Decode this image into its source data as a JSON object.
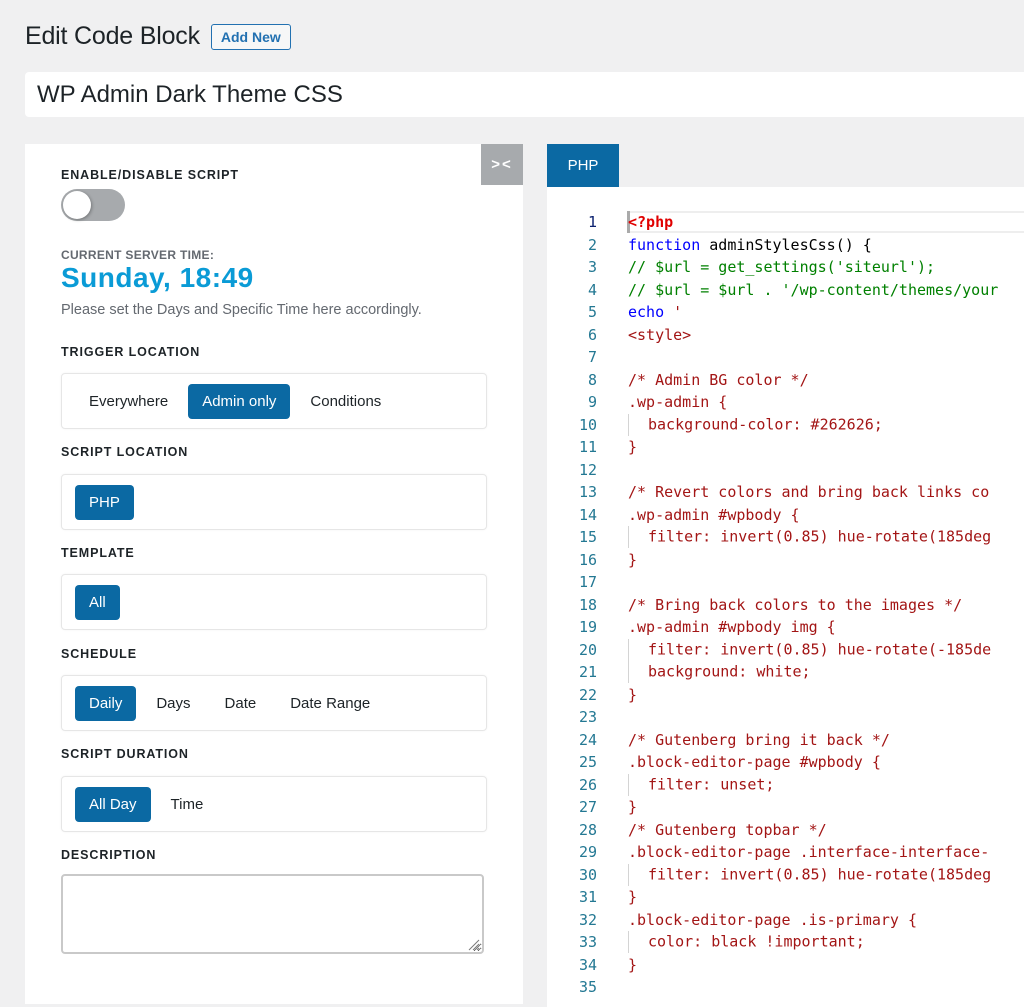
{
  "header": {
    "title": "Edit Code Block",
    "add_new_label": "Add New"
  },
  "post_title": "WP Admin Dark Theme CSS",
  "settings": {
    "collapse_icon": "collapse-arrows-icon",
    "collapse_label": "><",
    "enable_label": "ENABLE/DISABLE SCRIPT",
    "enabled": false,
    "server_time_label": "CURRENT SERVER TIME:",
    "server_time": "Sunday, 18:49",
    "server_hint": "Please set the Days and Specific Time here accordingly.",
    "trigger_location": {
      "label": "TRIGGER LOCATION",
      "options": [
        "Everywhere",
        "Admin only",
        "Conditions"
      ],
      "selected": "Admin only"
    },
    "script_location": {
      "label": "SCRIPT LOCATION",
      "options": [
        "PHP"
      ],
      "selected": "PHP"
    },
    "template": {
      "label": "TEMPLATE",
      "options": [
        "All"
      ],
      "selected": "All"
    },
    "schedule": {
      "label": "SCHEDULE",
      "options": [
        "Daily",
        "Days",
        "Date",
        "Date Range"
      ],
      "selected": "Daily"
    },
    "script_duration": {
      "label": "SCRIPT DURATION",
      "options": [
        "All Day",
        "Time"
      ],
      "selected": "All Day"
    },
    "description": {
      "label": "DESCRIPTION",
      "value": ""
    }
  },
  "editor": {
    "tab_label": "PHP",
    "lines": [
      {
        "n": "1",
        "indent": false,
        "tokens": [
          {
            "c": "t-php",
            "t": "<?php"
          }
        ]
      },
      {
        "n": "2",
        "indent": false,
        "tokens": [
          {
            "c": "t-kw",
            "t": "function"
          },
          {
            "c": "t-plain",
            "t": " adminStylesCss() {"
          }
        ]
      },
      {
        "n": "3",
        "indent": false,
        "tokens": [
          {
            "c": "t-cmt",
            "t": "// $url = get_settings('siteurl');"
          }
        ]
      },
      {
        "n": "4",
        "indent": false,
        "tokens": [
          {
            "c": "t-cmt",
            "t": "// $url = $url . '/wp-content/themes/your"
          }
        ]
      },
      {
        "n": "5",
        "indent": false,
        "tokens": [
          {
            "c": "t-kw",
            "t": "echo"
          },
          {
            "c": "t-css",
            "t": " '"
          }
        ]
      },
      {
        "n": "6",
        "indent": false,
        "tokens": [
          {
            "c": "t-css",
            "t": "<style>"
          }
        ]
      },
      {
        "n": "7",
        "indent": false,
        "tokens": []
      },
      {
        "n": "8",
        "indent": false,
        "tokens": [
          {
            "c": "t-css",
            "t": "/* Admin BG color */"
          }
        ]
      },
      {
        "n": "9",
        "indent": false,
        "tokens": [
          {
            "c": "t-css",
            "t": ".wp-admin {"
          }
        ]
      },
      {
        "n": "10",
        "indent": true,
        "tokens": [
          {
            "c": "t-css",
            "t": "background-color: #262626;"
          }
        ]
      },
      {
        "n": "11",
        "indent": false,
        "tokens": [
          {
            "c": "t-css",
            "t": "}"
          }
        ]
      },
      {
        "n": "12",
        "indent": false,
        "tokens": []
      },
      {
        "n": "13",
        "indent": false,
        "tokens": [
          {
            "c": "t-css",
            "t": "/* Revert colors and bring back links co"
          }
        ]
      },
      {
        "n": "14",
        "indent": false,
        "tokens": [
          {
            "c": "t-css",
            "t": ".wp-admin #wpbody {"
          }
        ]
      },
      {
        "n": "15",
        "indent": true,
        "tokens": [
          {
            "c": "t-css",
            "t": "filter: invert(0.85) hue-rotate(185deg"
          }
        ]
      },
      {
        "n": "16",
        "indent": false,
        "tokens": [
          {
            "c": "t-css",
            "t": "}"
          }
        ]
      },
      {
        "n": "17",
        "indent": false,
        "tokens": []
      },
      {
        "n": "18",
        "indent": false,
        "tokens": [
          {
            "c": "t-css",
            "t": "/* Bring back colors to the images */"
          }
        ]
      },
      {
        "n": "19",
        "indent": false,
        "tokens": [
          {
            "c": "t-css",
            "t": ".wp-admin #wpbody img {"
          }
        ]
      },
      {
        "n": "20",
        "indent": true,
        "tokens": [
          {
            "c": "t-css",
            "t": "filter: invert(0.85) hue-rotate(-185de"
          }
        ]
      },
      {
        "n": "21",
        "indent": true,
        "tokens": [
          {
            "c": "t-css",
            "t": "background: white;"
          }
        ]
      },
      {
        "n": "22",
        "indent": false,
        "tokens": [
          {
            "c": "t-css",
            "t": "}"
          }
        ]
      },
      {
        "n": "23",
        "indent": false,
        "tokens": []
      },
      {
        "n": "24",
        "indent": false,
        "tokens": [
          {
            "c": "t-css",
            "t": "/* Gutenberg bring it back */"
          }
        ]
      },
      {
        "n": "25",
        "indent": false,
        "tokens": [
          {
            "c": "t-css",
            "t": ".block-editor-page #wpbody {"
          }
        ]
      },
      {
        "n": "26",
        "indent": true,
        "tokens": [
          {
            "c": "t-css",
            "t": "filter: unset;"
          }
        ]
      },
      {
        "n": "27",
        "indent": false,
        "tokens": [
          {
            "c": "t-css",
            "t": "}"
          }
        ]
      },
      {
        "n": "28",
        "indent": false,
        "tokens": [
          {
            "c": "t-css",
            "t": "/* Gutenberg topbar */"
          }
        ]
      },
      {
        "n": "29",
        "indent": false,
        "tokens": [
          {
            "c": "t-css",
            "t": ".block-editor-page .interface-interface-"
          }
        ]
      },
      {
        "n": "30",
        "indent": true,
        "tokens": [
          {
            "c": "t-css",
            "t": "filter: invert(0.85) hue-rotate(185deg"
          }
        ]
      },
      {
        "n": "31",
        "indent": false,
        "tokens": [
          {
            "c": "t-css",
            "t": "}"
          }
        ]
      },
      {
        "n": "32",
        "indent": false,
        "tokens": [
          {
            "c": "t-css",
            "t": ".block-editor-page .is-primary {"
          }
        ]
      },
      {
        "n": "33",
        "indent": true,
        "tokens": [
          {
            "c": "t-css",
            "t": "color: black !important;"
          }
        ]
      },
      {
        "n": "34",
        "indent": false,
        "tokens": [
          {
            "c": "t-css",
            "t": "}"
          }
        ]
      },
      {
        "n": "35",
        "indent": false,
        "tokens": []
      }
    ]
  },
  "colors": {
    "accent": "#0b69a3",
    "server_time": "#0a9bd6",
    "link": "#2271b1"
  }
}
